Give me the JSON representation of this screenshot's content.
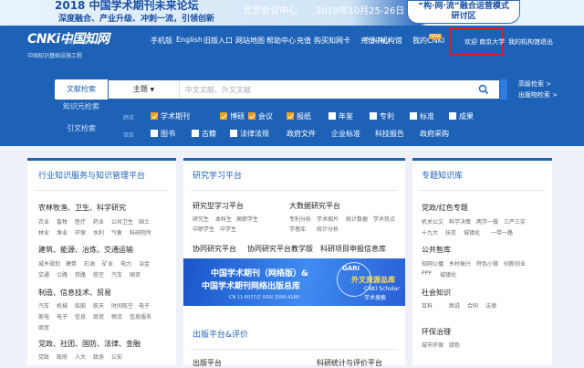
{
  "banner": {
    "title": "2018 中国学术期刊未来论坛",
    "subtitle": "深度融合、产业升级、冲刺一流，引领创新",
    "location": "北京会议中心",
    "date": "2018年10月25-26日",
    "badge_line1": "“构·网·流”融合运营模式",
    "badge_line2": "研讨区"
  },
  "header": {
    "logo": "CNKi中国知网",
    "logo_url": "www.cnki.net",
    "logo_slogan": "中国知识基础设施工程",
    "nav": [
      "手机版",
      "English",
      "旧版入口",
      "网站地图",
      "帮助中心",
      "充值",
      "购买知网卡",
      "充值中心",
      "个人/机构馆",
      "我的CNKI"
    ],
    "new_badge": "NEW",
    "welcome": "欢迎 南京大学",
    "my_org": "我的机构馆",
    "logout": "退出"
  },
  "search": {
    "tabs": [
      "文献检索",
      "知识元检索",
      "引文检索"
    ],
    "subject": "主题",
    "placeholder": "中文文献、外文文献",
    "advanced": "高级检索 >",
    "publish_search": "出版物检索 >",
    "row1_label": "跨库",
    "row2_label": "单库",
    "databases_row1": [
      {
        "label": "学术期刊",
        "checked": true
      },
      {
        "label": "博硕",
        "checked": true
      },
      {
        "label": "会议",
        "checked": true
      },
      {
        "label": "报纸",
        "checked": true
      },
      {
        "label": "年鉴",
        "checked": false
      },
      {
        "label": "专利",
        "checked": false
      },
      {
        "label": "标准",
        "checked": false
      },
      {
        "label": "成果",
        "checked": false
      }
    ],
    "databases_row2": [
      {
        "label": "图书",
        "checked": false
      },
      {
        "label": "古籍",
        "checked": false
      },
      {
        "label": "法律法规",
        "checked": false
      },
      {
        "label": "政府文件",
        "checked": null
      },
      {
        "label": "企业标准",
        "checked": null
      },
      {
        "label": "科技报告",
        "checked": null
      },
      {
        "label": "政府采购",
        "checked": null
      }
    ]
  },
  "panels": {
    "industry": {
      "title": "行业知识服务与知识管理平台",
      "groups": [
        {
          "name": "农林牧渔、卫生、科学研究",
          "items": [
            "农业",
            "畜牧",
            "医疗",
            "药业",
            "公共卫生",
            "国土",
            "林业",
            "渔业",
            "环保",
            "水利",
            "气象",
            "科研院所"
          ]
        },
        {
          "name": "建筑、能源、冶炼、交通运输",
          "items": [
            "城乡规划",
            "建筑",
            "石油",
            "矿业",
            "电力",
            "冶金",
            "交通",
            "公路",
            "铁路",
            "航空",
            "汽车",
            "国资"
          ]
        },
        {
          "name": "制造、信息技术、贸易",
          "items": [
            "汽车",
            "机械",
            "船舶",
            "航天",
            "时间航空",
            "电子",
            "家电",
            "电子",
            "信息",
            "商贸",
            "物流",
            "信息服务",
            "商贸"
          ]
        },
        {
          "name": "党政、社团、国防、法律、金融",
          "items": [
            "党政",
            "政府",
            "人大",
            "政协",
            "公安"
          ]
        }
      ]
    },
    "study": {
      "title": "研究学习平台",
      "research": "研究型学习平台",
      "research_items": [
        "研究生",
        "本科生",
        "高职学生",
        "中职学生",
        "中学生"
      ],
      "bigdata": "大数据研究平台",
      "bigdata_items": [
        "专利分析",
        "学术图片",
        "统计数据",
        "学术热点",
        "学者库",
        "学者库",
        "统计分析"
      ],
      "links": [
        "协同研究平台",
        "协同研究平台教学版",
        "科研项目申报信息库"
      ],
      "promo_title1": "中国学术期刊（网络版）&",
      "promo_title2": "中国学术期刊网络出版总库",
      "promo_issn": "CN 11-6037/Z   ISSN 2096-4188",
      "promo_gari": "GARI",
      "promo_foreign": "外文资源总库",
      "promo_scholar": "CNKI Scholar",
      "promo_search": "学术搜索",
      "publish_title": "出版平台&评价",
      "publish_items": [
        "出版平台",
        "科研统计与评价平台"
      ]
    },
    "topic": {
      "title": "专题知识库",
      "groups": [
        {
          "name": "党政/红色专题",
          "items": [
            "机关公文",
            "科学决策",
            "两学一做",
            "三严三实",
            "十九大",
            "扶贫",
            "城镇化",
            "一带一路"
          ]
        },
        {
          "name": "公共智库",
          "items": [
            "知网公播",
            "乡村振兴",
            "特色小镇",
            "创新创业",
            "PPP",
            "城镇化"
          ]
        },
        {
          "name": "社会知识",
          "items": [
            "百科",
            "图说",
            "合同",
            "法律"
          ]
        },
        {
          "name": "环保治理",
          "items": [
            "城市环保",
            "绿色"
          ]
        }
      ]
    }
  }
}
